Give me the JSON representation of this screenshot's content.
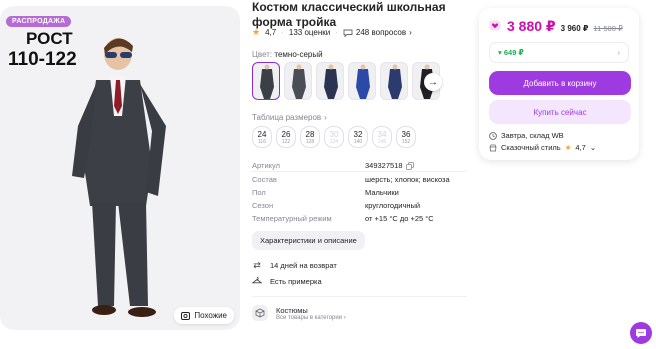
{
  "badge": "РАСПРОДАЖА",
  "photo_text": {
    "line1": "РОСТ",
    "line2": "110-122"
  },
  "similar_label": "Похожие",
  "title": "Костюм классический школьная форма тройка",
  "rating": {
    "value": "4,7",
    "reviews": "133 оценки",
    "questions": "248 вопросов"
  },
  "color": {
    "label": "Цвет:",
    "value": "темно-серый"
  },
  "sizes_label": "Таблица размеров",
  "sizes": [
    {
      "n": "24",
      "h": "116",
      "disabled": false
    },
    {
      "n": "26",
      "h": "122",
      "disabled": false
    },
    {
      "n": "28",
      "h": "128",
      "disabled": false
    },
    {
      "n": "30",
      "h": "134",
      "disabled": true
    },
    {
      "n": "32",
      "h": "140",
      "disabled": false
    },
    {
      "n": "34",
      "h": "146",
      "disabled": true
    },
    {
      "n": "36",
      "h": "152",
      "disabled": false
    }
  ],
  "specs": [
    {
      "k": "Артикул",
      "v": "349327518"
    },
    {
      "k": "Состав",
      "v": "шерсть; хлопок; вискоза"
    },
    {
      "k": "Пол",
      "v": "Мальчики"
    },
    {
      "k": "Сезон",
      "v": "круглогодичный"
    },
    {
      "k": "Температурный режим",
      "v": "от +15 °C до +25 °C"
    }
  ],
  "char_button": "Характеристики и описание",
  "features": {
    "return": "14 дней на возврат",
    "fitting": "Есть примерка"
  },
  "brand": {
    "title": "Костюмы",
    "sub": "Все товары в категории"
  },
  "price": {
    "main": "3 880 ₽",
    "secondary": "3 960 ₽",
    "old": "11 500 ₽"
  },
  "cashback": "649 ₽",
  "cart_button": "Добавить в корзину",
  "buy_button": "Купить сейчас",
  "delivery": "Завтра, склад WB",
  "seller": {
    "name": "Сказочный стиль",
    "rating": "4,7"
  },
  "colors": {
    "accent": "#cb11ab",
    "button": "#9e3be0",
    "cashback": "#1ab053"
  }
}
